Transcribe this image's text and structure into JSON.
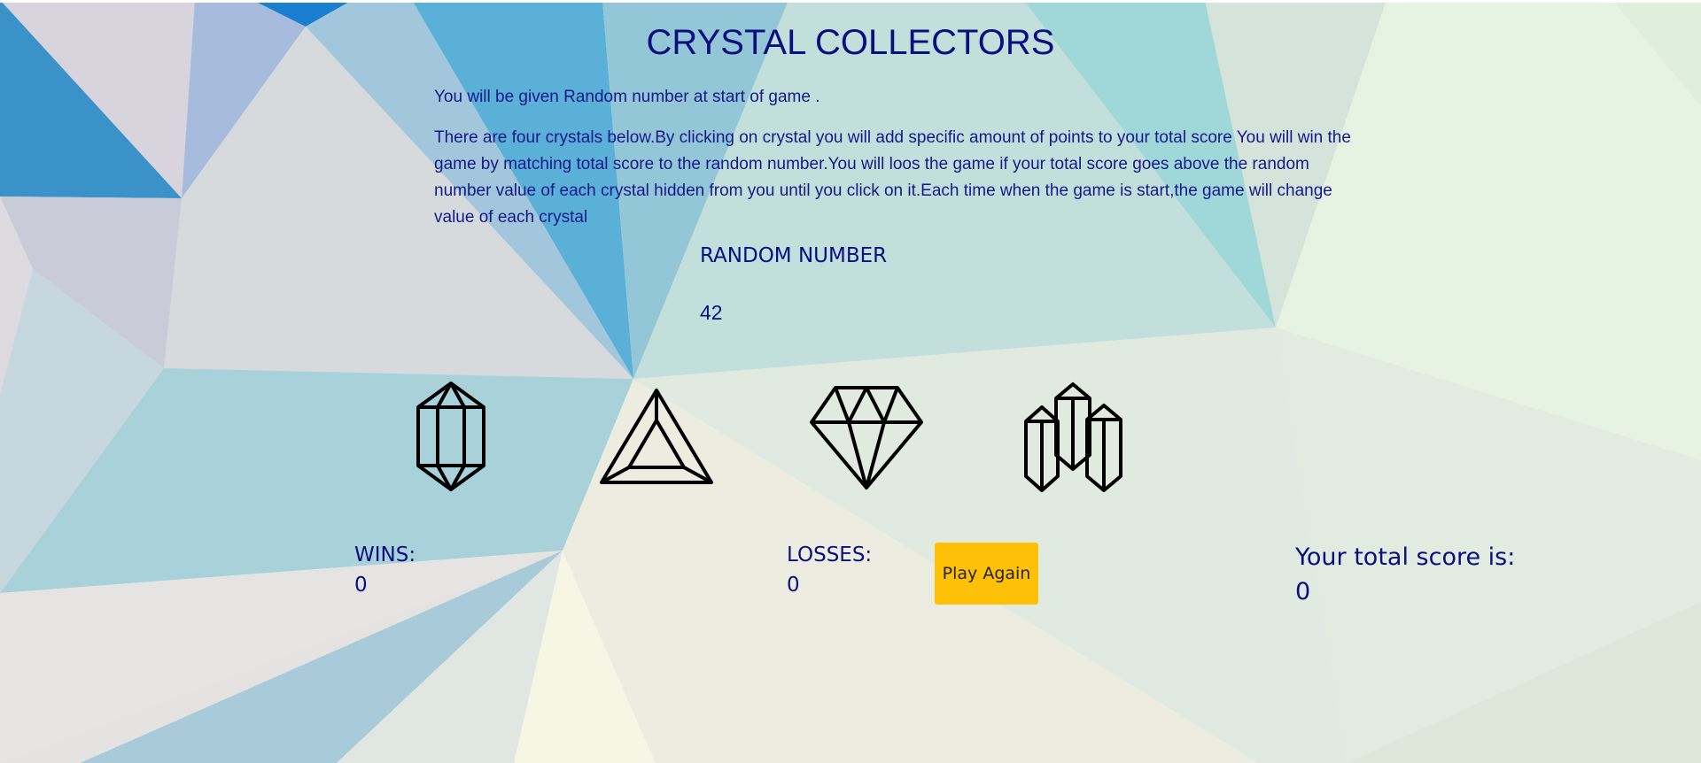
{
  "header": {
    "title": "CRYSTAL COLLECTORS"
  },
  "instructions": {
    "intro": "You will be given Random number at start of game .",
    "rules": "There are four crystals below.By clicking on crystal you will add specific amount of points to your total score You will win the game by matching total score to the random number.You will loos the game if your total score goes above the random number value of each crystal hidden from you until you click on it.Each time when the game is start,the game will change value of each crystal"
  },
  "random_number": {
    "label": "RANDOM NUMBER",
    "value": "42"
  },
  "crystals": [
    {
      "icon": "hexagonal-crystal-icon"
    },
    {
      "icon": "triangle-crystal-icon"
    },
    {
      "icon": "diamond-crystal-icon"
    },
    {
      "icon": "crystal-cluster-icon"
    }
  ],
  "stats": {
    "wins_label": "WINS:",
    "wins_value": "0",
    "losses_label": "LOSSES:",
    "losses_value": "0"
  },
  "controls": {
    "play_again_label": "Play Again"
  },
  "score": {
    "label": "Your total score is:",
    "value": "0"
  },
  "colors": {
    "text": "#0a0f80",
    "button": "#ffc107",
    "accent_blue": "#3a96cc",
    "teal": "#9fd6d8",
    "light_green": "#e7f3e3"
  }
}
